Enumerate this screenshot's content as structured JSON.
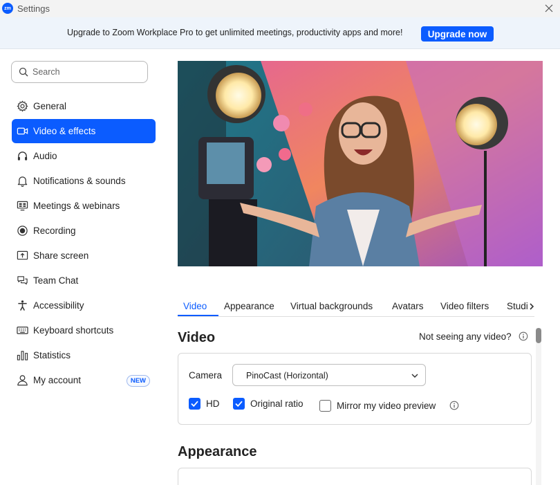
{
  "window": {
    "title": "Settings",
    "logo_text": "zm"
  },
  "banner": {
    "text": "Upgrade to Zoom Workplace Pro to get unlimited meetings, productivity apps and more!",
    "button": "Upgrade now"
  },
  "search": {
    "placeholder": "Search"
  },
  "sidebar": {
    "items": [
      {
        "label": "General",
        "icon": "gear-icon"
      },
      {
        "label": "Video & effects",
        "icon": "video-camera-icon",
        "active": true
      },
      {
        "label": "Audio",
        "icon": "headphones-icon"
      },
      {
        "label": "Notifications & sounds",
        "icon": "bell-icon"
      },
      {
        "label": "Meetings & webinars",
        "icon": "meeting-screen-icon"
      },
      {
        "label": "Recording",
        "icon": "record-icon"
      },
      {
        "label": "Share screen",
        "icon": "share-screen-icon"
      },
      {
        "label": "Team Chat",
        "icon": "chat-bubbles-icon"
      },
      {
        "label": "Accessibility",
        "icon": "accessibility-icon"
      },
      {
        "label": "Keyboard shortcuts",
        "icon": "keyboard-icon"
      },
      {
        "label": "Statistics",
        "icon": "bar-chart-icon"
      },
      {
        "label": "My account",
        "icon": "person-icon",
        "badge": "NEW"
      }
    ]
  },
  "tabs": [
    "Video",
    "Appearance",
    "Virtual backgrounds",
    "Avatars",
    "Video filters",
    "Studio"
  ],
  "video_section": {
    "title": "Video",
    "help": "Not seeing any video?",
    "camera_label": "Camera",
    "camera_value": "PinoCast (Horizontal)",
    "options": [
      {
        "label": "HD",
        "checked": true
      },
      {
        "label": "Original ratio",
        "checked": true
      },
      {
        "label": "Mirror my video preview",
        "checked": false
      }
    ]
  },
  "appearance_section": {
    "title": "Appearance"
  },
  "colors": {
    "accent": "#0b5cff",
    "banner_bg": "#eef4fb"
  }
}
